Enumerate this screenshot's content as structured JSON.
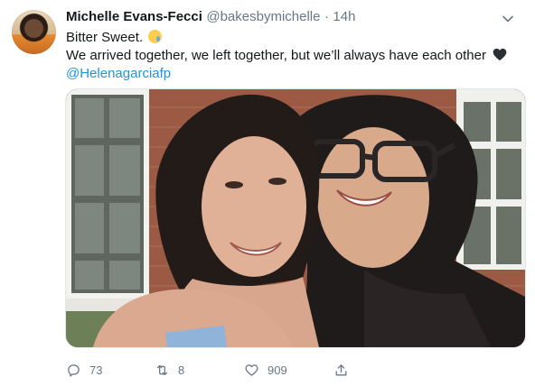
{
  "tweet": {
    "display_name": "Michelle Evans-Fecci",
    "handle": "@bakesbymichelle",
    "separator": "·",
    "time": "14h",
    "line1": "Bitter Sweet.",
    "line2": "We arrived together, we left together, but we’ll always have each other",
    "mention": "@Helenagarciafp",
    "emoji_1": "crying-face",
    "emoji_2": "black-heart"
  },
  "actions": {
    "replies": "73",
    "retweets": "8",
    "likes": "909"
  },
  "colors": {
    "link": "#1b95e0",
    "secondary_text": "#657786",
    "primary_text": "#14171a"
  },
  "icons": [
    "caret-down-icon",
    "reply-icon",
    "retweet-icon",
    "like-icon",
    "share-icon"
  ]
}
